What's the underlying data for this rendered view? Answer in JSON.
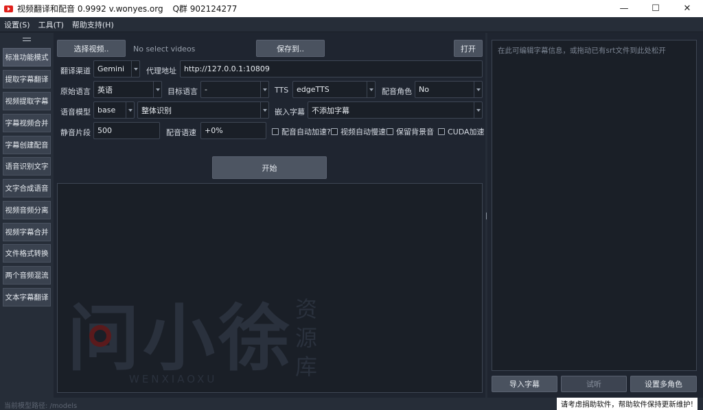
{
  "window": {
    "title": "视频翻译和配音 0.9992 v.wonyes.org",
    "qq_group": "Q群 902124277",
    "controls": {
      "minimize": "—",
      "maximize": "☐",
      "close": "✕"
    }
  },
  "menu": [
    "设置(S)",
    "工具(T)",
    "帮助支持(H)"
  ],
  "sidebar": {
    "items": [
      {
        "label": "标准功能模式",
        "active": true
      },
      {
        "label": "提取字幕翻译"
      },
      {
        "label": "视频提取字幕"
      },
      {
        "label": "字幕视频合并"
      },
      {
        "label": "字幕创建配音"
      },
      {
        "label": "语音识别文字"
      },
      {
        "label": "文字合成语音"
      },
      {
        "label": "视频音频分离"
      },
      {
        "label": "视频字幕合并"
      },
      {
        "label": "文件格式转换"
      },
      {
        "label": "两个音频混流"
      },
      {
        "label": "文本字幕翻译"
      }
    ]
  },
  "toolbar": {
    "select_video": "选择视频..",
    "no_select": "No select videos",
    "save_to": "保存到..",
    "open": "打开"
  },
  "form": {
    "translate_channel_label": "翻译渠道",
    "translate_channel": "Gemini",
    "proxy_label": "代理地址",
    "proxy": "http://127.0.0.1:10809",
    "source_lang_label": "原始语言",
    "source_lang": "英语",
    "target_lang_label": "目标语言",
    "target_lang": "-",
    "tts_label": "TTS",
    "tts": "edgeTTS",
    "voice_role_label": "配音角色",
    "voice_role": "No",
    "model_label": "语音模型",
    "model": "base",
    "recog_mode": "整体识别",
    "embed_sub_label": "嵌入字幕",
    "embed_sub": "不添加字幕",
    "silence_label": "静音片段",
    "silence": "500",
    "speed_label": "配音语速",
    "speed": "+0%",
    "checks": [
      "配音自动加速?",
      "视频自动慢速",
      "保留背景音",
      "CUDA加速"
    ],
    "start": "开始"
  },
  "right_panel": {
    "placeholder": "在此可编辑字幕信息，或拖动已有srt文件到此处松开",
    "import": "导入字幕",
    "preview": "试听",
    "multi_role": "设置多角色"
  },
  "watermark": {
    "big": [
      "问",
      "小",
      "徐"
    ],
    "side": [
      "资",
      "源",
      "库"
    ],
    "pinyin": "WENXIAOXU"
  },
  "status": {
    "left": "当前模型路径: /models",
    "right": "请考虑捐助软件，帮助软件保持更新维护!"
  }
}
